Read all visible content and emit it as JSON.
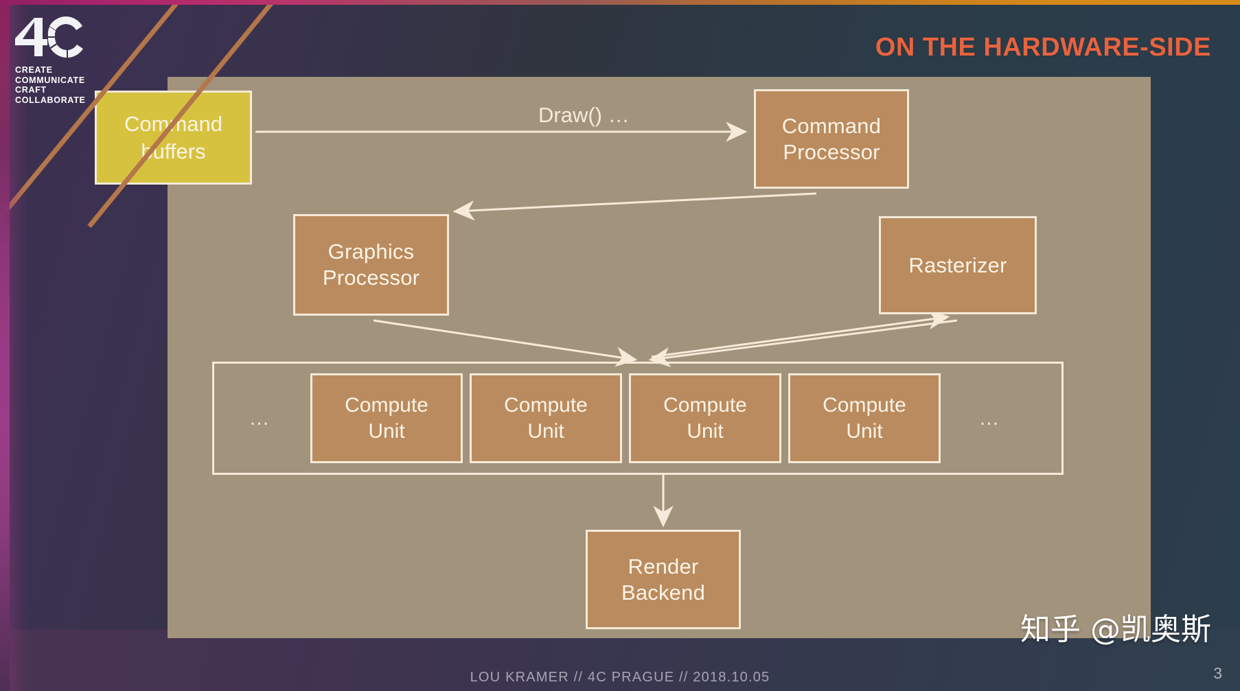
{
  "slide": {
    "title": "ON THE HARDWARE-SIDE",
    "title_color": "#e8633f",
    "background_color": "#2c3b49",
    "panel_color": "#a2937c",
    "node_color": "#b98b5e",
    "node_border_color": "#f6ead8",
    "highlight_node_color": "#d6c23f",
    "accent_color": "#9d3a86"
  },
  "logo": {
    "mark": "4C",
    "tagline": "CREATE\nCOMMUNICATE\nCRAFT\nCOLLABORATE"
  },
  "diagram": {
    "command_buffers": "Command\nbuffers",
    "draw_label": "Draw() …",
    "command_processor": "Command\nProcessor",
    "graphics_processor": "Graphics\nProcessor",
    "rasterizer": "Rasterizer",
    "render_backend": "Render\nBackend",
    "compute_units": [
      {
        "label": "Compute\nUnit"
      },
      {
        "label": "Compute\nUnit"
      },
      {
        "label": "Compute\nUnit"
      },
      {
        "label": "Compute\nUnit"
      }
    ],
    "ellipsis_left": "…",
    "ellipsis_right": "…"
  },
  "footer": {
    "credits": "LOU KRAMER // 4C PRAGUE // 2018.10.05",
    "page_number": "3"
  },
  "watermark": {
    "text": "知乎 @凯奥斯"
  }
}
